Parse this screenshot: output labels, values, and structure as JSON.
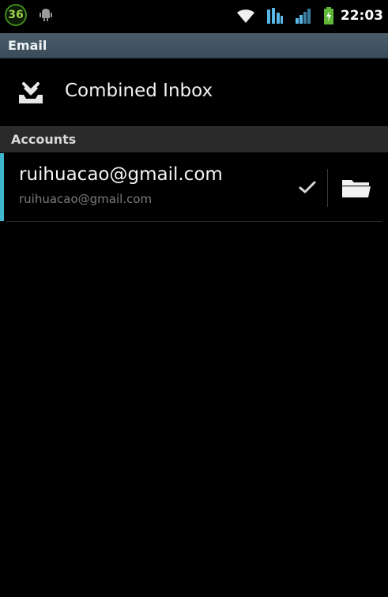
{
  "status_bar": {
    "notification_count": "36",
    "time": "22:03"
  },
  "title_bar": {
    "title": "Email"
  },
  "combined_inbox": {
    "label": "Combined Inbox",
    "icon": "inbox-tray-icon"
  },
  "accounts_section": {
    "title": "Accounts"
  },
  "accounts": [
    {
      "name": "ruihuacao@gmail.com",
      "email": "ruihuacao@gmail.com",
      "selected": true
    }
  ],
  "colors": {
    "title_bar": "#43586a",
    "accent": "#3fb7cf",
    "badge": "#3f8a1e"
  }
}
